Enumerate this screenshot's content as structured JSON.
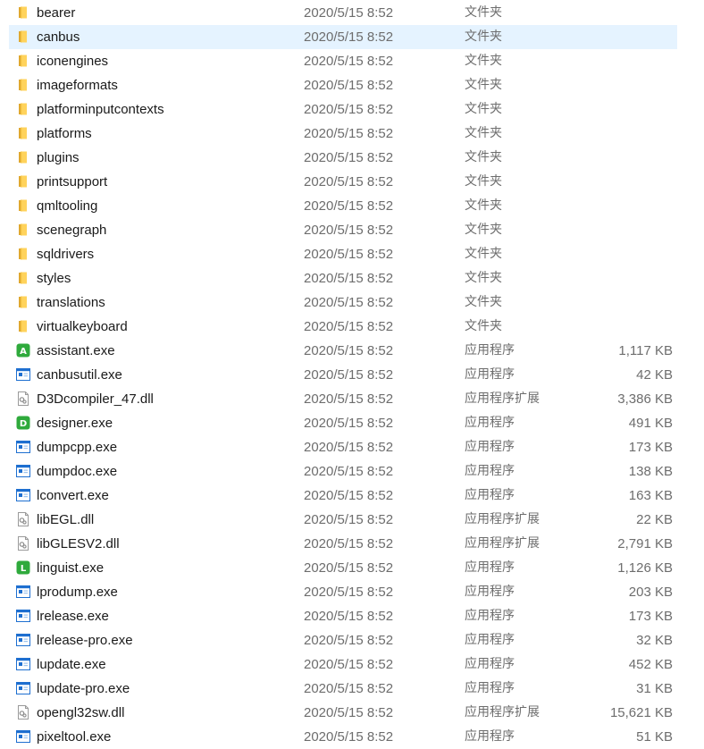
{
  "colors": {
    "folder": "#ffd35c",
    "selection": "#e5f3ff",
    "exe_blue": "#1e6fd0",
    "badge_green": "#2faa3c",
    "secondary_text": "#6d6d6d"
  },
  "files": [
    {
      "name": "bearer",
      "date": "2020/5/15 8:52",
      "type": "文件夹",
      "size": "",
      "icon": "folder-icon"
    },
    {
      "name": "canbus",
      "date": "2020/5/15 8:52",
      "type": "文件夹",
      "size": "",
      "icon": "folder-icon",
      "selected": true
    },
    {
      "name": "iconengines",
      "date": "2020/5/15 8:52",
      "type": "文件夹",
      "size": "",
      "icon": "folder-icon"
    },
    {
      "name": "imageformats",
      "date": "2020/5/15 8:52",
      "type": "文件夹",
      "size": "",
      "icon": "folder-icon"
    },
    {
      "name": "platforminputcontexts",
      "date": "2020/5/15 8:52",
      "type": "文件夹",
      "size": "",
      "icon": "folder-icon"
    },
    {
      "name": "platforms",
      "date": "2020/5/15 8:52",
      "type": "文件夹",
      "size": "",
      "icon": "folder-icon"
    },
    {
      "name": "plugins",
      "date": "2020/5/15 8:52",
      "type": "文件夹",
      "size": "",
      "icon": "folder-icon"
    },
    {
      "name": "printsupport",
      "date": "2020/5/15 8:52",
      "type": "文件夹",
      "size": "",
      "icon": "folder-icon"
    },
    {
      "name": "qmltooling",
      "date": "2020/5/15 8:52",
      "type": "文件夹",
      "size": "",
      "icon": "folder-icon"
    },
    {
      "name": "scenegraph",
      "date": "2020/5/15 8:52",
      "type": "文件夹",
      "size": "",
      "icon": "folder-icon"
    },
    {
      "name": "sqldrivers",
      "date": "2020/5/15 8:52",
      "type": "文件夹",
      "size": "",
      "icon": "folder-icon"
    },
    {
      "name": "styles",
      "date": "2020/5/15 8:52",
      "type": "文件夹",
      "size": "",
      "icon": "folder-icon"
    },
    {
      "name": "translations",
      "date": "2020/5/15 8:52",
      "type": "文件夹",
      "size": "",
      "icon": "folder-icon"
    },
    {
      "name": "virtualkeyboard",
      "date": "2020/5/15 8:52",
      "type": "文件夹",
      "size": "",
      "icon": "folder-icon"
    },
    {
      "name": "assistant.exe",
      "date": "2020/5/15 8:52",
      "type": "应用程序",
      "size": "1,117 KB",
      "icon": "assistant-app-icon",
      "badge": "A"
    },
    {
      "name": "canbusutil.exe",
      "date": "2020/5/15 8:52",
      "type": "应用程序",
      "size": "42 KB",
      "icon": "exe-icon"
    },
    {
      "name": "D3Dcompiler_47.dll",
      "date": "2020/5/15 8:52",
      "type": "应用程序扩展",
      "size": "3,386 KB",
      "icon": "dll-icon"
    },
    {
      "name": "designer.exe",
      "date": "2020/5/15 8:52",
      "type": "应用程序",
      "size": "491 KB",
      "icon": "designer-app-icon",
      "badge": "D"
    },
    {
      "name": "dumpcpp.exe",
      "date": "2020/5/15 8:52",
      "type": "应用程序",
      "size": "173 KB",
      "icon": "exe-icon"
    },
    {
      "name": "dumpdoc.exe",
      "date": "2020/5/15 8:52",
      "type": "应用程序",
      "size": "138 KB",
      "icon": "exe-icon"
    },
    {
      "name": "lconvert.exe",
      "date": "2020/5/15 8:52",
      "type": "应用程序",
      "size": "163 KB",
      "icon": "exe-icon"
    },
    {
      "name": "libEGL.dll",
      "date": "2020/5/15 8:52",
      "type": "应用程序扩展",
      "size": "22 KB",
      "icon": "dll-icon"
    },
    {
      "name": "libGLESV2.dll",
      "date": "2020/5/15 8:52",
      "type": "应用程序扩展",
      "size": "2,791 KB",
      "icon": "dll-icon"
    },
    {
      "name": "linguist.exe",
      "date": "2020/5/15 8:52",
      "type": "应用程序",
      "size": "1,126 KB",
      "icon": "linguist-app-icon",
      "badge": "L"
    },
    {
      "name": "lprodump.exe",
      "date": "2020/5/15 8:52",
      "type": "应用程序",
      "size": "203 KB",
      "icon": "exe-icon"
    },
    {
      "name": "lrelease.exe",
      "date": "2020/5/15 8:52",
      "type": "应用程序",
      "size": "173 KB",
      "icon": "exe-icon"
    },
    {
      "name": "lrelease-pro.exe",
      "date": "2020/5/15 8:52",
      "type": "应用程序",
      "size": "32 KB",
      "icon": "exe-icon"
    },
    {
      "name": "lupdate.exe",
      "date": "2020/5/15 8:52",
      "type": "应用程序",
      "size": "452 KB",
      "icon": "exe-icon"
    },
    {
      "name": "lupdate-pro.exe",
      "date": "2020/5/15 8:52",
      "type": "应用程序",
      "size": "31 KB",
      "icon": "exe-icon"
    },
    {
      "name": "opengl32sw.dll",
      "date": "2020/5/15 8:52",
      "type": "应用程序扩展",
      "size": "15,621 KB",
      "icon": "dll-icon"
    },
    {
      "name": "pixeltool.exe",
      "date": "2020/5/15 8:52",
      "type": "应用程序",
      "size": "51 KB",
      "icon": "exe-icon"
    }
  ]
}
